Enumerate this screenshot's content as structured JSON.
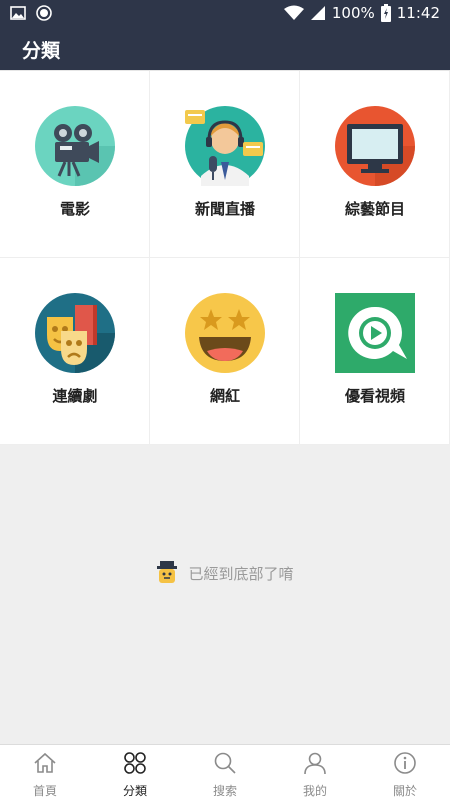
{
  "status_bar": {
    "battery": "100%",
    "time": "11:42",
    "icons": [
      "image-icon",
      "record-icon",
      "wifi-icon",
      "signal-icon",
      "battery-icon"
    ]
  },
  "header": {
    "title": "分類"
  },
  "categories": [
    {
      "label": "電影",
      "icon": "movie-camera-icon"
    },
    {
      "label": "新聞直播",
      "icon": "news-anchor-icon"
    },
    {
      "label": "綜藝節目",
      "icon": "tv-screen-icon"
    },
    {
      "label": "連續劇",
      "icon": "drama-masks-icon"
    },
    {
      "label": "網紅",
      "icon": "star-eyes-emoji-icon"
    },
    {
      "label": "優看視頻",
      "icon": "youkan-play-logo-icon"
    }
  ],
  "footer_note": {
    "text": "已經到底部了唷",
    "icon": "mascot-icon"
  },
  "tabbar": {
    "tabs": [
      {
        "label": "首頁",
        "icon": "home-icon",
        "active": false
      },
      {
        "label": "分類",
        "icon": "grid-icon",
        "active": true
      },
      {
        "label": "搜索",
        "icon": "search-icon",
        "active": false
      },
      {
        "label": "我的",
        "icon": "user-icon",
        "active": false
      },
      {
        "label": "關於",
        "icon": "info-icon",
        "active": false
      }
    ]
  },
  "colors": {
    "header_bg": "#2e3649",
    "page_bg": "#efefef",
    "tab_active": "#222222",
    "tab_inactive": "#8b8b8b"
  }
}
